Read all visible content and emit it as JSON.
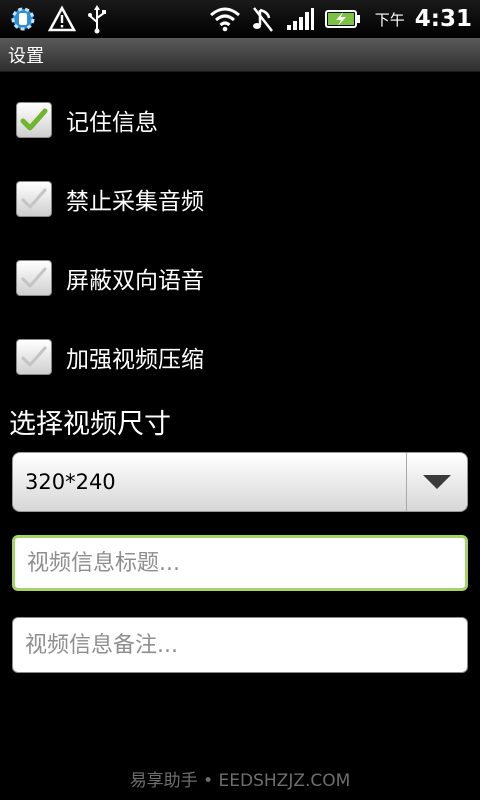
{
  "status_bar": {
    "icons_left": [
      "settings-sync-icon",
      "warning-icon",
      "usb-icon"
    ],
    "icons_right": [
      "wifi-icon",
      "music-muted-icon",
      "signal-icon",
      "battery-charging-icon"
    ],
    "ampm": "下午",
    "time": "4:31"
  },
  "title_bar": {
    "title": "设置"
  },
  "options": [
    {
      "label": "记住信息",
      "checked": true
    },
    {
      "label": "禁止采集音频",
      "checked": false
    },
    {
      "label": "屏蔽双向语音",
      "checked": false
    },
    {
      "label": "加强视频压缩",
      "checked": false
    }
  ],
  "video_size": {
    "heading": "选择视频尺寸",
    "selected": "320*240"
  },
  "fields": {
    "title_placeholder": "视频信息标题...",
    "title_value": "",
    "note_placeholder": "视频信息备注...",
    "note_value": ""
  },
  "watermark": "易享助手 • EEDSHZJZ.COM",
  "colors": {
    "check_active": "#6fb52e",
    "check_inactive": "#c4c4c4",
    "focus_border": "#a6d26a"
  }
}
